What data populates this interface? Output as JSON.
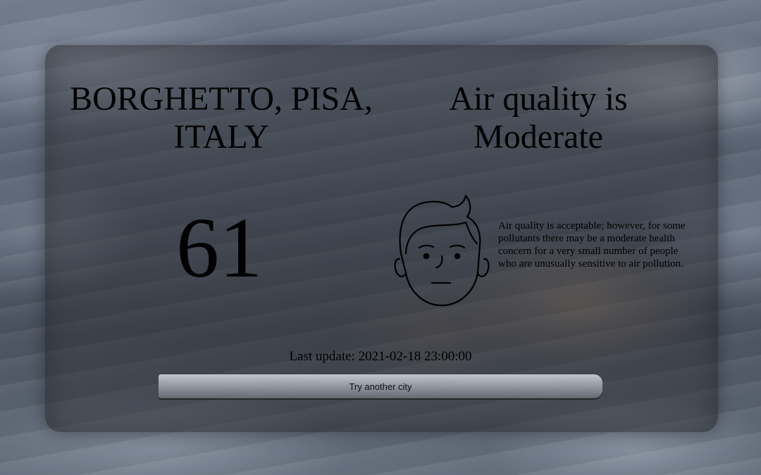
{
  "location": {
    "line1": "BORGHETTO, PISA,",
    "line2": "ITALY"
  },
  "status": {
    "line1": "Air quality is",
    "line2": "Moderate"
  },
  "aqi_value": "61",
  "face_icon": "neutral-face-icon",
  "description": "Air quality is acceptable; however, for some pollutants there may be a moderate health concern for a very small number of people who are unusually sensitive to air pollution.",
  "last_update": "Last update: 2021-02-18 23:00:00",
  "button": {
    "label": "Try another city"
  },
  "colors": {
    "card_overlay": "#28282c",
    "text": "#000000",
    "button": "#c8ccd3"
  }
}
